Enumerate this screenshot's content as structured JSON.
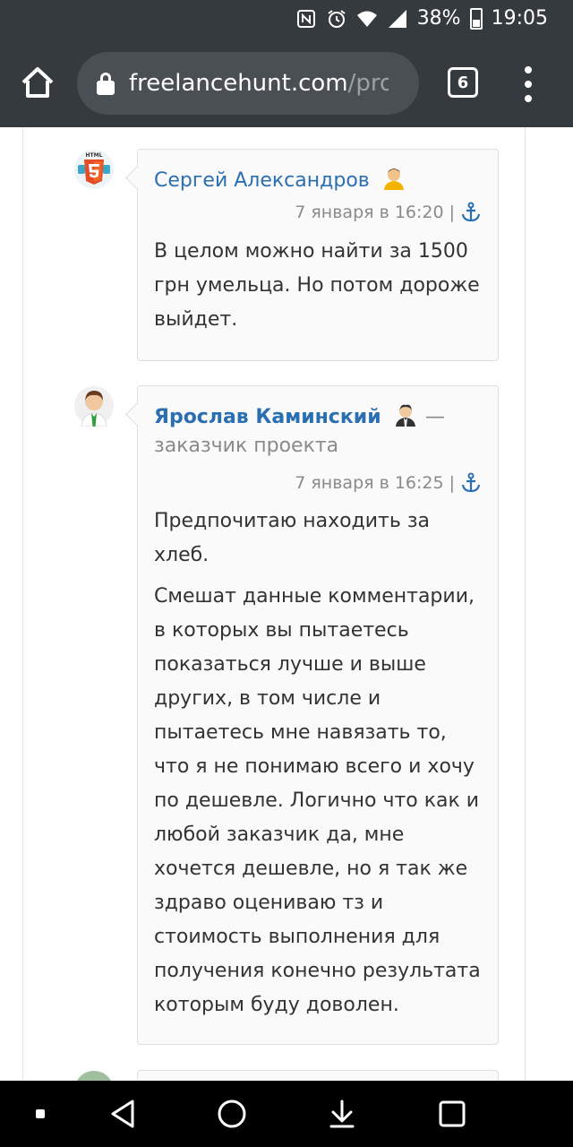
{
  "status_bar": {
    "battery": "38%",
    "time": "19:05"
  },
  "browser": {
    "url_main": "freelancehunt.com",
    "url_rest": "/pro",
    "tab_count": "6"
  },
  "comments": [
    {
      "author": "Сергей Александров",
      "timestamp": "7 января в 16:20",
      "separator": "|",
      "paragraphs": [
        "В целом можно найти за 1500 грн умельца. Но потом дороже выйдет."
      ]
    },
    {
      "author": "Ярослав Каминский",
      "dash": "—",
      "role": "заказчик проекта",
      "timestamp": "7 января в 16:25",
      "separator": "|",
      "paragraphs": [
        "Предпочитаю находить за хлеб.",
        "Смешат данные комментарии, в которых вы пытаетесь показаться лучше и выше других, в том числе и пытаетесь мне навязать то, что я не понимаю всего и хочу по дешевле. Логично что как и любой заказчик да, мне хочется дешевле, но я так же здраво оцениваю тз и стоимость выполнения для получения конечно результата которым буду доволен."
      ]
    }
  ]
}
